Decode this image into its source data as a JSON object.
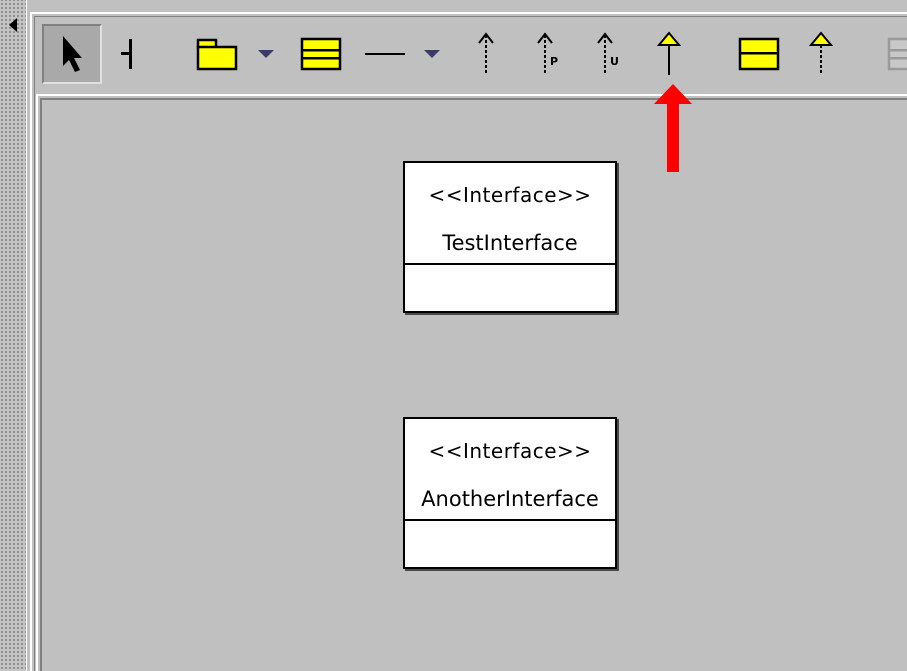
{
  "toolbar": {
    "tools": [
      {
        "id": "select",
        "icon": "pointer-arrow-icon",
        "selected": true
      },
      {
        "id": "anchor",
        "icon": "anchor-line-icon"
      },
      {
        "id": "package",
        "icon": "folder-package-icon",
        "has_dropdown": true
      },
      {
        "id": "class",
        "icon": "class-box-icon"
      },
      {
        "id": "association",
        "icon": "line-association-icon",
        "has_dropdown": true
      },
      {
        "id": "dependency",
        "icon": "dashed-arrow-icon"
      },
      {
        "id": "dependency-permission",
        "icon": "dashed-arrow-p-icon",
        "letter": "P"
      },
      {
        "id": "dependency-usage",
        "icon": "dashed-arrow-u-icon",
        "letter": "U"
      },
      {
        "id": "generalization",
        "icon": "realization-arrow-icon"
      },
      {
        "id": "interface",
        "icon": "interface-box-icon"
      },
      {
        "id": "realization",
        "icon": "dashed-realization-arrow-icon"
      },
      {
        "id": "more",
        "icon": "grayed-box-icon",
        "disabled": true
      }
    ]
  },
  "diagram": {
    "interfaces": [
      {
        "stereotype": "<<Interface>>",
        "name": "TestInterface"
      },
      {
        "stereotype": "<<Interface>>",
        "name": "AnotherInterface"
      }
    ]
  },
  "colors": {
    "background": "#c0c0c0",
    "icon_yellow": "#ffff00",
    "annotation_red": "#ff0000"
  }
}
